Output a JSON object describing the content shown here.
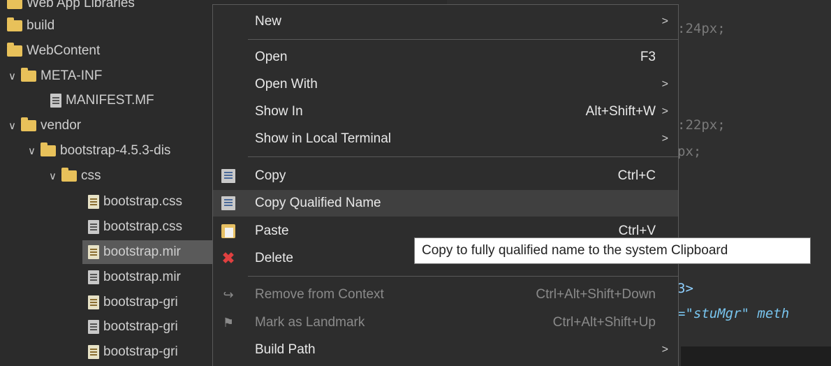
{
  "explorer": {
    "items": [
      {
        "label": "Web App Libraries",
        "type": "lib"
      },
      {
        "label": "build",
        "type": "folder"
      },
      {
        "label": "WebContent",
        "type": "folder"
      },
      {
        "label": "META-INF",
        "type": "folder",
        "expanded": true
      },
      {
        "label": "MANIFEST.MF",
        "type": "file"
      },
      {
        "label": "vendor",
        "type": "folder",
        "expanded": true
      },
      {
        "label": "bootstrap-4.5.3-dis",
        "type": "folder",
        "expanded": true
      },
      {
        "label": "css",
        "type": "folder",
        "expanded": true
      },
      {
        "label": "bootstrap.css",
        "type": "css-file"
      },
      {
        "label": "bootstrap.css",
        "type": "css-file"
      },
      {
        "label": "bootstrap.mir",
        "type": "css-file",
        "selected": true
      },
      {
        "label": "bootstrap.mir",
        "type": "css-file"
      },
      {
        "label": "bootstrap-gri",
        "type": "css-file"
      },
      {
        "label": "bootstrap-gri",
        "type": "css-file"
      },
      {
        "label": "bootstrap-gri",
        "type": "css-file"
      }
    ]
  },
  "editor": {
    "lines": [
      ":24px;",
      ":22px;",
      "px;",
      "3>",
      "=\"stuMgr\" meth"
    ]
  },
  "context_menu": {
    "items": {
      "new": {
        "label": "New",
        "submenu": true
      },
      "open": {
        "label": "Open",
        "shortcut": "F3"
      },
      "open_with": {
        "label": "Open With",
        "submenu": true
      },
      "show_in": {
        "label": "Show In",
        "shortcut": "Alt+Shift+W",
        "submenu": true
      },
      "show_terminal": {
        "label": "Show in Local Terminal",
        "submenu": true
      },
      "copy": {
        "label": "Copy",
        "shortcut": "Ctrl+C",
        "icon": "copy-icon"
      },
      "copy_qualified": {
        "label": "Copy Qualified Name",
        "icon": "copy-qualified-icon",
        "hovered": true
      },
      "paste": {
        "label": "Paste",
        "shortcut": "Ctrl+V",
        "icon": "paste-icon"
      },
      "delete": {
        "label": "Delete",
        "icon": "delete-icon"
      },
      "remove_context": {
        "label": "Remove from Context",
        "shortcut": "Ctrl+Alt+Shift+Down",
        "disabled": true,
        "icon": "remove-context-icon"
      },
      "mark_landmark": {
        "label": "Mark as Landmark",
        "shortcut": "Ctrl+Alt+Shift+Up",
        "disabled": true,
        "icon": "landmark-icon"
      },
      "build_path": {
        "label": "Build Path",
        "submenu": true
      }
    },
    "submenu_arrow": ">"
  },
  "tooltip": {
    "text": "Copy to fully qualified name to the system Clipboard"
  },
  "colors": {
    "background": "#2b2b2b",
    "menu_background": "#2d2d2d",
    "hover": "#404040",
    "folder": "#e8c15a",
    "delete": "#e04040"
  }
}
